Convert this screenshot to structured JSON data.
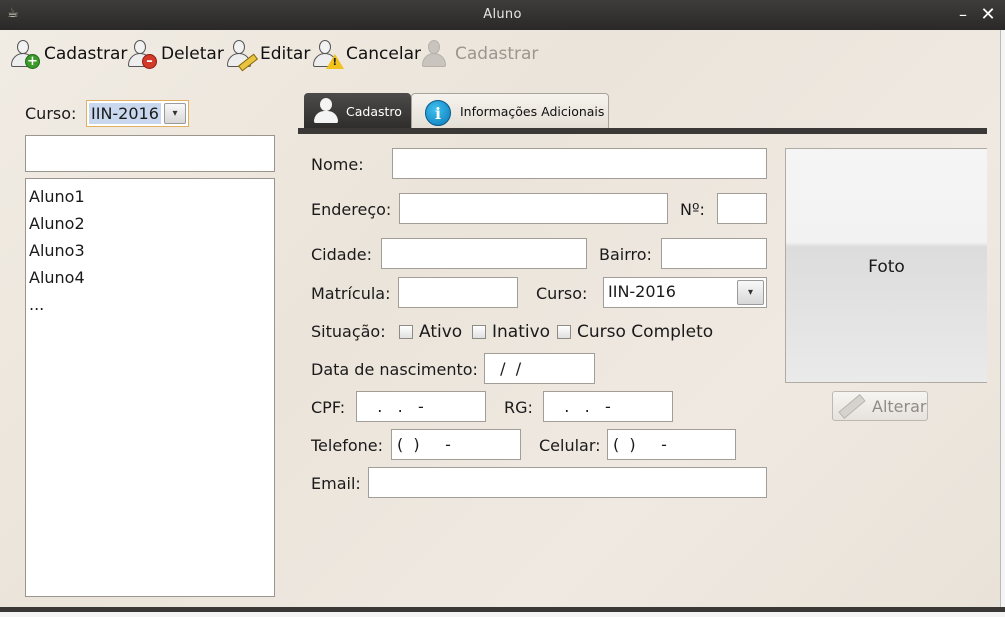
{
  "window": {
    "title": "Aluno",
    "minimize": "–",
    "close": "✕"
  },
  "toolbar": {
    "cadastrar": "Cadastrar",
    "deletar": "Deletar",
    "editar": "Editar",
    "cancelar": "Cancelar",
    "cadastrar_disabled": "Cadastrar"
  },
  "left": {
    "curso_label": "Curso:",
    "curso_value": "IIN-2016",
    "search_value": "",
    "students": [
      "Aluno1",
      "Aluno2",
      "Aluno3",
      "Aluno4",
      "..."
    ]
  },
  "tabs": {
    "cadastro": "Cadastro",
    "info": "Informações Adicionais"
  },
  "form": {
    "nome_label": "Nome:",
    "nome_value": "",
    "endereco_label": "Endereço:",
    "endereco_value": "",
    "numero_label": "Nº:",
    "numero_value": "",
    "cidade_label": "Cidade:",
    "cidade_value": "",
    "bairro_label": "Bairro:",
    "bairro_value": "",
    "matricula_label": "Matrícula:",
    "matricula_value": "",
    "curso_label": "Curso:",
    "curso_value": "IIN-2016",
    "situacao_label": "Situação:",
    "situacao_options": [
      "Ativo",
      "Inativo",
      "Curso Completo"
    ],
    "nascimento_label": "Data de nascimento:",
    "nascimento_value": "  /  /",
    "cpf_label": "CPF:",
    "cpf_value": "   .   .   -",
    "rg_label": "RG:",
    "rg_value": "   .   .   -",
    "telefone_label": "Telefone:",
    "telefone_value": "(  )     -",
    "celular_label": "Celular:",
    "celular_value": "(  )     -",
    "email_label": "Email:",
    "email_value": ""
  },
  "photo": {
    "label": "Foto",
    "alterar": "Alterar"
  }
}
